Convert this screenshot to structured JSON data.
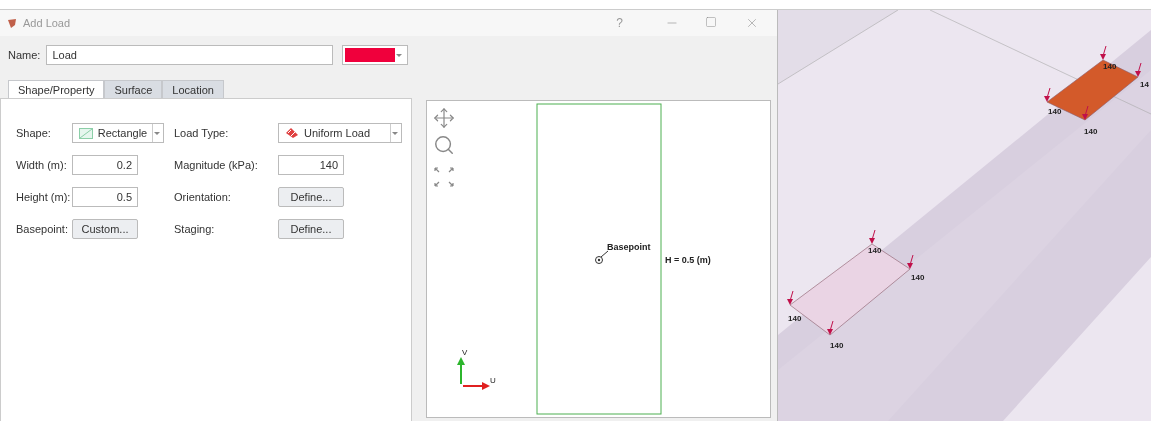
{
  "window": {
    "title": "Add Load",
    "help": "?"
  },
  "name": {
    "label": "Name:",
    "value": "Load",
    "color": "#f0003c"
  },
  "tabs": [
    {
      "label": "Shape/Property",
      "selected": true
    },
    {
      "label": "Surface",
      "selected": false
    },
    {
      "label": "Location",
      "selected": false
    }
  ],
  "form_left": [
    {
      "kind": "select",
      "label": "Shape:",
      "value": "Rectangle"
    },
    {
      "kind": "input",
      "label": "Width (m):",
      "value": "0.2"
    },
    {
      "kind": "input",
      "label": "Height (m):",
      "value": "0.5"
    },
    {
      "kind": "button",
      "label": "Basepoint:",
      "value": "Custom..."
    }
  ],
  "form_right": [
    {
      "kind": "select",
      "label": "Load Type:",
      "value": "Uniform Load"
    },
    {
      "kind": "input",
      "label": "Magnitude (kPa):",
      "value": "140"
    },
    {
      "kind": "button",
      "label": "Orientation:",
      "value": "Define..."
    },
    {
      "kind": "button",
      "label": "Staging:",
      "value": "Define..."
    }
  ],
  "preview": {
    "basepoint_label": "Basepoint",
    "height_label": "H = 0.5 (m)",
    "axis_v": "V",
    "axis_u": "U"
  },
  "scene": {
    "loads": [
      {
        "color": "#d35a2a",
        "labels": [
          "140",
          "14",
          "140",
          "140"
        ]
      },
      {
        "color": "#ead4e4",
        "labels": [
          "140",
          "140",
          "140",
          "140"
        ]
      }
    ]
  }
}
